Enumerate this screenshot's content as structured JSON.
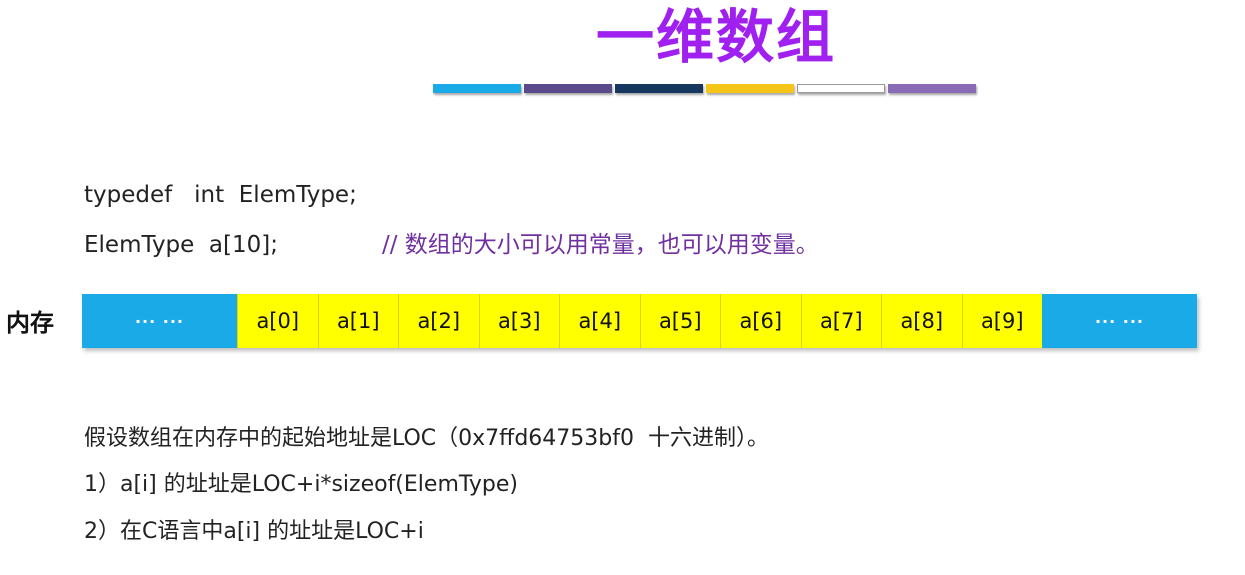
{
  "title": "一维数组",
  "colors": {
    "title": "#a020f0",
    "comment": "#7030a0",
    "memory_edge": "#1aaae8",
    "memory_element": "#ffff00",
    "color_bar": [
      "#1aaae8",
      "#5b4a8a",
      "#16375e",
      "#f5c518",
      "#ffffff",
      "#8a6bb5"
    ]
  },
  "code": {
    "line1": "typedef   int  ElemType;",
    "line2": "ElemType  a[10];",
    "comment": "// 数组的大小可以用常量，也可以用变量。"
  },
  "memory": {
    "label": "内存",
    "edge_left": "··· ···",
    "edge_right": "··· ···",
    "elements": [
      "a[0]",
      "a[1]",
      "a[2]",
      "a[3]",
      "a[4]",
      "a[5]",
      "a[6]",
      "a[7]",
      "a[8]",
      "a[9]"
    ]
  },
  "notes": {
    "line1": "假设数组在内存中的起始地址是LOC（0x7ffd64753bf0  十六进制）。",
    "line2": "1）a[i] 的址址是LOC+i*sizeof(ElemType)",
    "line3": "2）在C语言中a[i] 的址址是LOC+i"
  }
}
